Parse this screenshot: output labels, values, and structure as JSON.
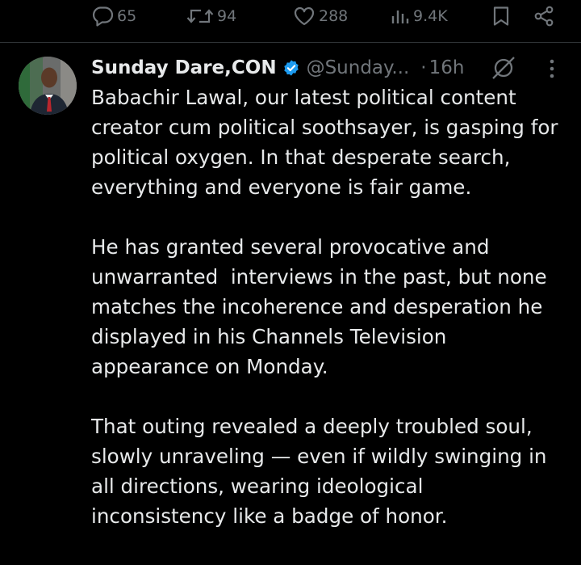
{
  "prev_actions": {
    "replies": "65",
    "reposts": "94",
    "likes": "288",
    "views": "9.4K"
  },
  "tweet": {
    "author_name": "Sunday Dare,CON",
    "handle": "@Sunday...",
    "separator": "·",
    "time": "16h",
    "paragraphs": [
      [
        "Babachir Lawal, our latest political content",
        "creator cum political soothsayer, is gasping for",
        "political oxygen. In that desperate search,",
        "everything and everyone is fair game."
      ],
      [
        "He has granted several provocative and",
        "unwarranted  interviews in the past, but none",
        "matches the incoherence and desperation he",
        "displayed in his Channels Television",
        "appearance on Monday."
      ],
      [
        "That outing revealed a deeply troubled soul,",
        "slowly unraveling — even if wildly swinging in",
        "all directions, wearing ideological",
        "inconsistency like a badge of honor."
      ]
    ]
  },
  "colors": {
    "background": "#000000",
    "text": "#e7e9ea",
    "secondary": "#71767b",
    "verified": "#1d9bf0",
    "divider": "#2f3336"
  },
  "icons": [
    "reply-icon",
    "repost-icon",
    "like-icon",
    "views-icon",
    "bookmark-icon",
    "share-icon",
    "verified-badge-icon",
    "grok-icon",
    "more-icon"
  ]
}
